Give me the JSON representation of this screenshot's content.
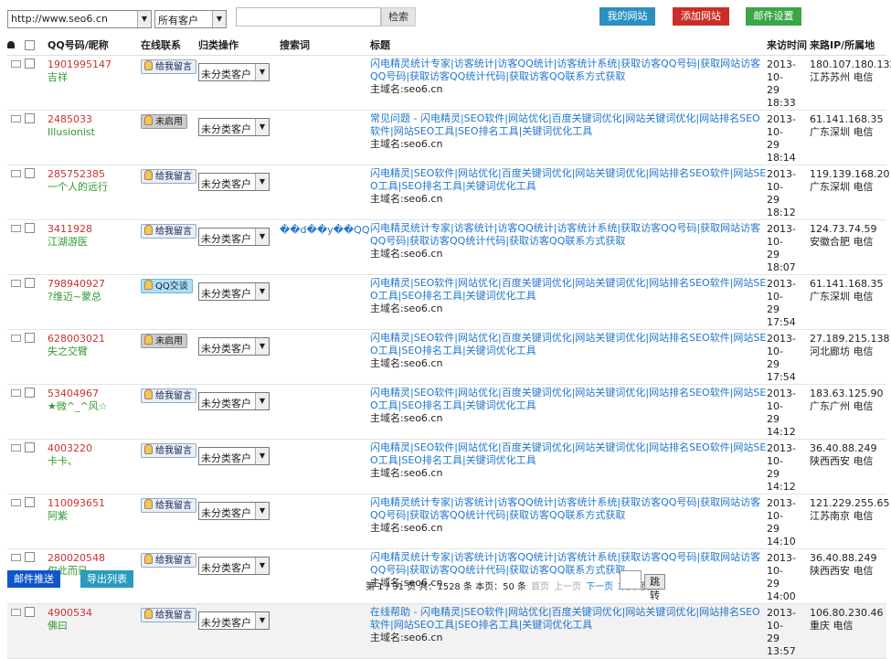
{
  "toolbar": {
    "site_select": "http://www.seo6.cn",
    "customer_select": "所有客户",
    "keyword_value": "",
    "search_label": "检索",
    "my_sites_label": "我的网站",
    "add_site_label": "添加网站",
    "mail_settings_label": "邮件设置"
  },
  "colors": {
    "my_sites": "#2b8fbf",
    "add_site": "#cc2e27",
    "mail_settings": "#3aa648",
    "mail_push": "#1155cc",
    "export": "#2a9bbd",
    "link": "#2277cc"
  },
  "table": {
    "headers": {
      "qq": "QQ号码/昵称",
      "contact": "在线联系",
      "category": "归类操作",
      "keyword": "搜索词",
      "title": "标题",
      "time": "来访时间",
      "ip": "来路IP/所属地"
    },
    "rows": [
      {
        "qq": "1901995147",
        "nick": "吉祥",
        "contact": "给我留言",
        "contact_type": "msg",
        "category": "未分类客户",
        "keyword": "",
        "title": "闪电精灵统计专家|访客统计|访客QQ统计|访客统计系统|获取访客QQ号码|获取网站访客QQ号码|获取访客QQ统计代码|获取访客QQ联系方式获取",
        "domain": "主域名:seo6.cn",
        "date": "2013-10-",
        "day": "29",
        "clock": "18:33",
        "ip": "180.107.180.132",
        "loc": "江苏苏州 电信"
      },
      {
        "qq": "2485033",
        "nick": "Illusionist",
        "contact": "未启用",
        "contact_type": "off",
        "category": "未分类客户",
        "keyword": "",
        "title": "常见问题 - 闪电精灵|SEO软件|网站优化|百度关键词优化|网站关键词优化|网站排名SEO软件|网站SEO工具|SEO排名工具|关键词优化工具",
        "domain": "主域名:seo6.cn",
        "date": "2013-10-",
        "day": "29",
        "clock": "18:14",
        "ip": "61.141.168.35",
        "loc": "广东深圳 电信"
      },
      {
        "qq": "285752385",
        "nick": "一个人的远行",
        "contact": "给我留言",
        "contact_type": "msg",
        "category": "未分类客户",
        "keyword": "",
        "title": "闪电精灵|SEO软件|网站优化|百度关键词优化|网站关键词优化|网站排名SEO软件|网站SEO工具|SEO排名工具|关键词优化工具",
        "domain": "主域名:seo6.cn",
        "date": "2013-10-",
        "day": "29",
        "clock": "18:12",
        "ip": "119.139.168.20",
        "loc": "广东深圳 电信"
      },
      {
        "qq": "3411928",
        "nick": "江湖游医",
        "contact": "给我留言",
        "contact_type": "msg",
        "category": "未分类客户",
        "keyword": "��d��y��QQ����",
        "title": "闪电精灵统计专家|访客统计|访客QQ统计|访客统计系统|获取访客QQ号码|获取网站访客QQ号码|获取访客QQ统计代码|获取访客QQ联系方式获取",
        "domain": "主域名:seo6.cn",
        "date": "2013-10-",
        "day": "29",
        "clock": "18:07",
        "ip": "124.73.74.59",
        "loc": "安徽合肥 电信"
      },
      {
        "qq": "798940927",
        "nick": "?维迈~蒙总",
        "contact": "QQ交谈",
        "contact_type": "talk",
        "category": "未分类客户",
        "keyword": "",
        "title": "闪电精灵|SEO软件|网站优化|百度关键词优化|网站关键词优化|网站排名SEO软件|网站SEO工具|SEO排名工具|关键词优化工具",
        "domain": "主域名:seo6.cn",
        "date": "2013-10-",
        "day": "29",
        "clock": "17:54",
        "ip": "61.141.168.35",
        "loc": "广东深圳 电信"
      },
      {
        "qq": "628003021",
        "nick": "失之交臂",
        "contact": "未启用",
        "contact_type": "off",
        "category": "未分类客户",
        "keyword": "",
        "title": "闪电精灵|SEO软件|网站优化|百度关键词优化|网站关键词优化|网站排名SEO软件|网站SEO工具|SEO排名工具|关键词优化工具",
        "domain": "主域名:seo6.cn",
        "date": "2013-10-",
        "day": "29",
        "clock": "17:54",
        "ip": "27.189.215.138",
        "loc": "河北廊坊 电信"
      },
      {
        "qq": "53404967",
        "nick": "★微^_^风☆",
        "contact": "给我留言",
        "contact_type": "msg",
        "category": "未分类客户",
        "keyword": "",
        "title": "闪电精灵|SEO软件|网站优化|百度关键词优化|网站关键词优化|网站排名SEO软件|网站SEO工具|SEO排名工具|关键词优化工具",
        "domain": "主域名:seo6.cn",
        "date": "2013-10-",
        "day": "29",
        "clock": "14:12",
        "ip": "183.63.125.90",
        "loc": "广东广州 电信"
      },
      {
        "qq": "4003220",
        "nick": "卡卡、",
        "contact": "给我留言",
        "contact_type": "msg",
        "category": "未分类客户",
        "keyword": "",
        "title": "闪电精灵|SEO软件|网站优化|百度关键词优化|网站关键词优化|网站排名SEO软件|网站SEO工具|SEO排名工具|关键词优化工具",
        "domain": "主域名:seo6.cn",
        "date": "2013-10-",
        "day": "29",
        "clock": "14:12",
        "ip": "36.40.88.249",
        "loc": "陕西西安 电信"
      },
      {
        "qq": "110093651",
        "nick": "阿紫",
        "contact": "给我留言",
        "contact_type": "msg",
        "category": "未分类客户",
        "keyword": "",
        "title": "闪电精灵统计专家|访客统计|访客QQ统计|访客统计系统|获取访客QQ号码|获取网站访客QQ号码|获取访客QQ统计代码|获取访客QQ联系方式获取",
        "domain": "主域名:seo6.cn",
        "date": "2013-10-",
        "day": "29",
        "clock": "14:10",
        "ip": "121.229.255.65",
        "loc": "江苏南京 电信"
      },
      {
        "qq": "280020548",
        "nick": "仅此而已",
        "contact": "给我留言",
        "contact_type": "msg",
        "category": "未分类客户",
        "keyword": "",
        "title": "闪电精灵统计专家|访客统计|访客QQ统计|访客统计系统|获取访客QQ号码|获取网站访客QQ号码|获取访客QQ统计代码|获取访客QQ联系方式获取",
        "domain": "主域名:seo6.cn",
        "date": "2013-10-",
        "day": "29",
        "clock": "14:00",
        "ip": "36.40.88.249",
        "loc": "陕西西安 电信"
      },
      {
        "qq": "4900534",
        "nick": "佛曰",
        "contact": "给我留言",
        "contact_type": "msg",
        "category": "未分类客户",
        "keyword": "",
        "title": "在线帮助 - 闪电精灵|SEO软件|网站优化|百度关键词优化|网站关键词优化|网站排名SEO软件|网站SEO工具|SEO排名工具|关键词优化工具",
        "domain": "主域名:seo6.cn",
        "date": "2013-10-",
        "day": "29",
        "clock": "13:57",
        "ip": "106.80.230.46",
        "loc": "重庆 电信"
      }
    ]
  },
  "footer": {
    "mail_push_label": "邮件推送",
    "export_label": "导出列表",
    "summary": "第 1 / 31 页 共：1528 条 本页：50 条",
    "first": "首页",
    "prev": "上一页",
    "next": "下一页",
    "last": "末页",
    "page_count_label": "页数:",
    "page_input": "",
    "jump_label": "跳转"
  }
}
